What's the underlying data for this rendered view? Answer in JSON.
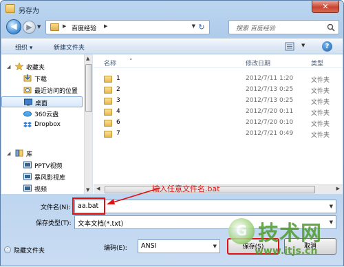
{
  "window": {
    "title": "另存为",
    "close_label": "✕"
  },
  "nav": {
    "back_icon": "◀",
    "forward_icon": "▶",
    "address": {
      "path": "百度经验",
      "refresh_icon": "↻"
    },
    "search": {
      "placeholder": "搜索 百度经验"
    }
  },
  "toolbar": {
    "organize_label": "组织 ▾",
    "new_folder_label": "新建文件夹",
    "help_label": "?"
  },
  "sidebar": {
    "items": [
      {
        "label": "收藏夹",
        "icon": "star-icon"
      },
      {
        "label": "下载",
        "icon": "download-icon"
      },
      {
        "label": "最近访问的位置",
        "icon": "recent-places-icon"
      },
      {
        "label": "桌面",
        "icon": "desktop-icon",
        "selected": true
      },
      {
        "label": "360云盘",
        "icon": "cloud-disk-icon"
      },
      {
        "label": "Dropbox",
        "icon": "dropbox-icon"
      },
      {
        "label": "库",
        "icon": "library-icon"
      },
      {
        "label": "PPTV视频",
        "icon": "video-icon"
      },
      {
        "label": "暴风影视库",
        "icon": "video-icon"
      },
      {
        "label": "视频",
        "icon": "video-icon"
      }
    ]
  },
  "filelist": {
    "columns": {
      "name": "名称",
      "modified": "修改日期",
      "type": "类型"
    },
    "rows": [
      {
        "name": "1",
        "modified": "2012/7/11 1:20",
        "type": "文件夹"
      },
      {
        "name": "2",
        "modified": "2012/7/13 0:25",
        "type": "文件夹"
      },
      {
        "name": "3",
        "modified": "2012/7/13 0:25",
        "type": "文件夹"
      },
      {
        "name": "4",
        "modified": "2012/7/20 0:11",
        "type": "文件夹"
      },
      {
        "name": "6",
        "modified": "2012/7/20 0:10",
        "type": "文件夹"
      },
      {
        "name": "7",
        "modified": "2012/7/21 0:49",
        "type": "文件夹"
      }
    ]
  },
  "form": {
    "filename_label": "文件名(N):",
    "filename_value": "aa.bat",
    "filetype_label": "保存类型(T):",
    "filetype_value": "文本文档(*.txt)",
    "encoding_label": "编码(E):",
    "encoding_value": "ANSI",
    "hide_folders_label": "隐藏文件夹",
    "save_label": "保存(S)",
    "cancel_label": "取消"
  },
  "annotation": {
    "text": "输入任意文件名.bat",
    "color": "#e01010"
  },
  "watermark": {
    "logo_text": "G",
    "text": "技术网",
    "url": "www.itjs.cn"
  },
  "colors": {
    "accent": "#3d8bd6",
    "annotation": "#e01010",
    "watermark": "#4e9a2d"
  }
}
